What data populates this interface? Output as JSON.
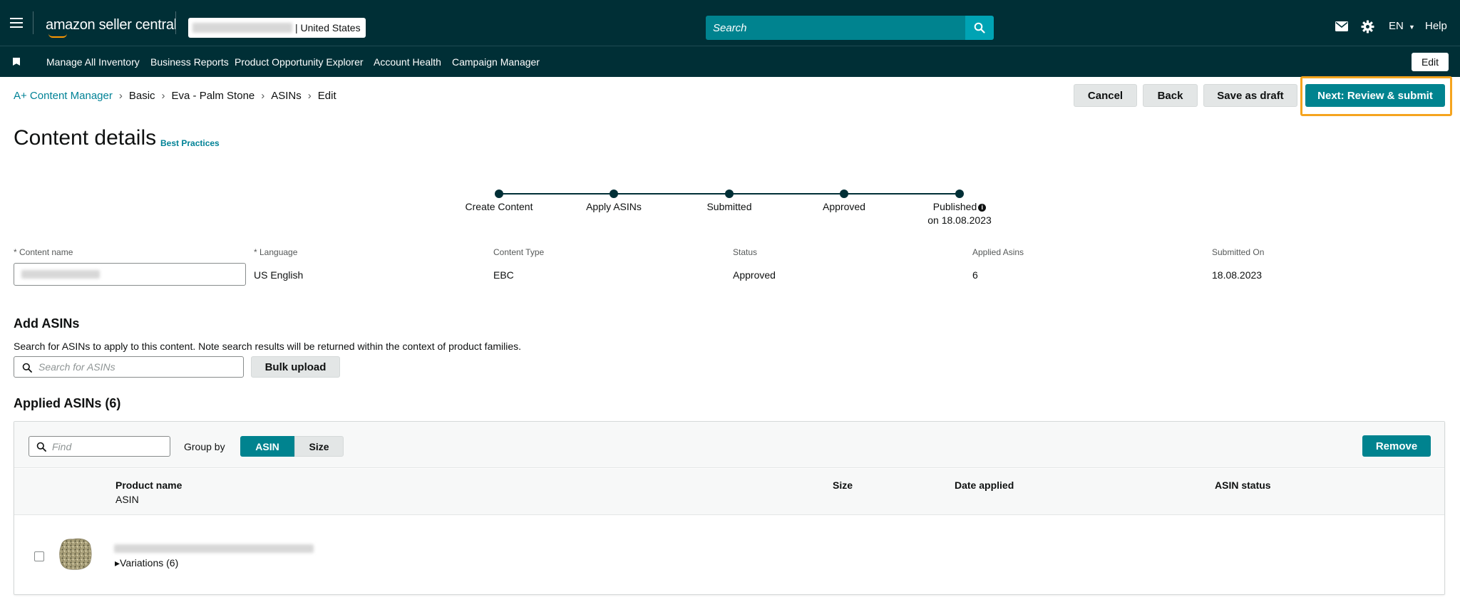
{
  "header": {
    "logo": "amazon seller central",
    "store_suffix": "| United States",
    "search_placeholder": "Search",
    "language": "EN",
    "help": "Help"
  },
  "nav": {
    "items": [
      "Manage All Inventory",
      "Business Reports",
      "Product Opportunity Explorer",
      "Account Health",
      "Campaign Manager"
    ],
    "edit": "Edit"
  },
  "breadcrumb": [
    "A+ Content Manager",
    "Basic",
    "Eva - Palm Stone",
    "ASINs",
    "Edit"
  ],
  "actions": {
    "cancel": "Cancel",
    "back": "Back",
    "save_draft": "Save as draft",
    "next": "Next: Review & submit"
  },
  "page": {
    "title": "Content details",
    "best_practices": "Best Practices"
  },
  "stepper": {
    "steps": [
      "Create Content",
      "Apply ASINs",
      "Submitted",
      "Approved",
      "Published"
    ],
    "published_date": "on 18.08.2023"
  },
  "details": {
    "content_name_label": "* Content name",
    "language_label": "* Language",
    "language_value": "US English",
    "content_type_label": "Content Type",
    "content_type_value": "EBC",
    "status_label": "Status",
    "status_value": "Approved",
    "applied_asins_label": "Applied Asins",
    "applied_asins_value": "6",
    "submitted_on_label": "Submitted On",
    "submitted_on_value": "18.08.2023"
  },
  "add_asins": {
    "title": "Add ASINs",
    "description": "Search for ASINs to apply to this content. Note search results will be returned within the context of product families.",
    "search_placeholder": "Search for ASINs",
    "bulk_upload": "Bulk upload"
  },
  "applied": {
    "title": "Applied ASINs (6)",
    "find_placeholder": "Find",
    "group_by": "Group by",
    "group_options": [
      "ASIN",
      "Size"
    ],
    "remove": "Remove",
    "columns": {
      "product_name": "Product name",
      "asin": "ASIN",
      "size": "Size",
      "date_applied": "Date applied",
      "asin_status": "ASIN status"
    },
    "rows": [
      {
        "variations": "▸Variations (6)"
      }
    ]
  },
  "colors": {
    "header_bg": "#002f36",
    "accent": "#00838f",
    "link": "#008296",
    "highlight": "#f5a41e"
  }
}
